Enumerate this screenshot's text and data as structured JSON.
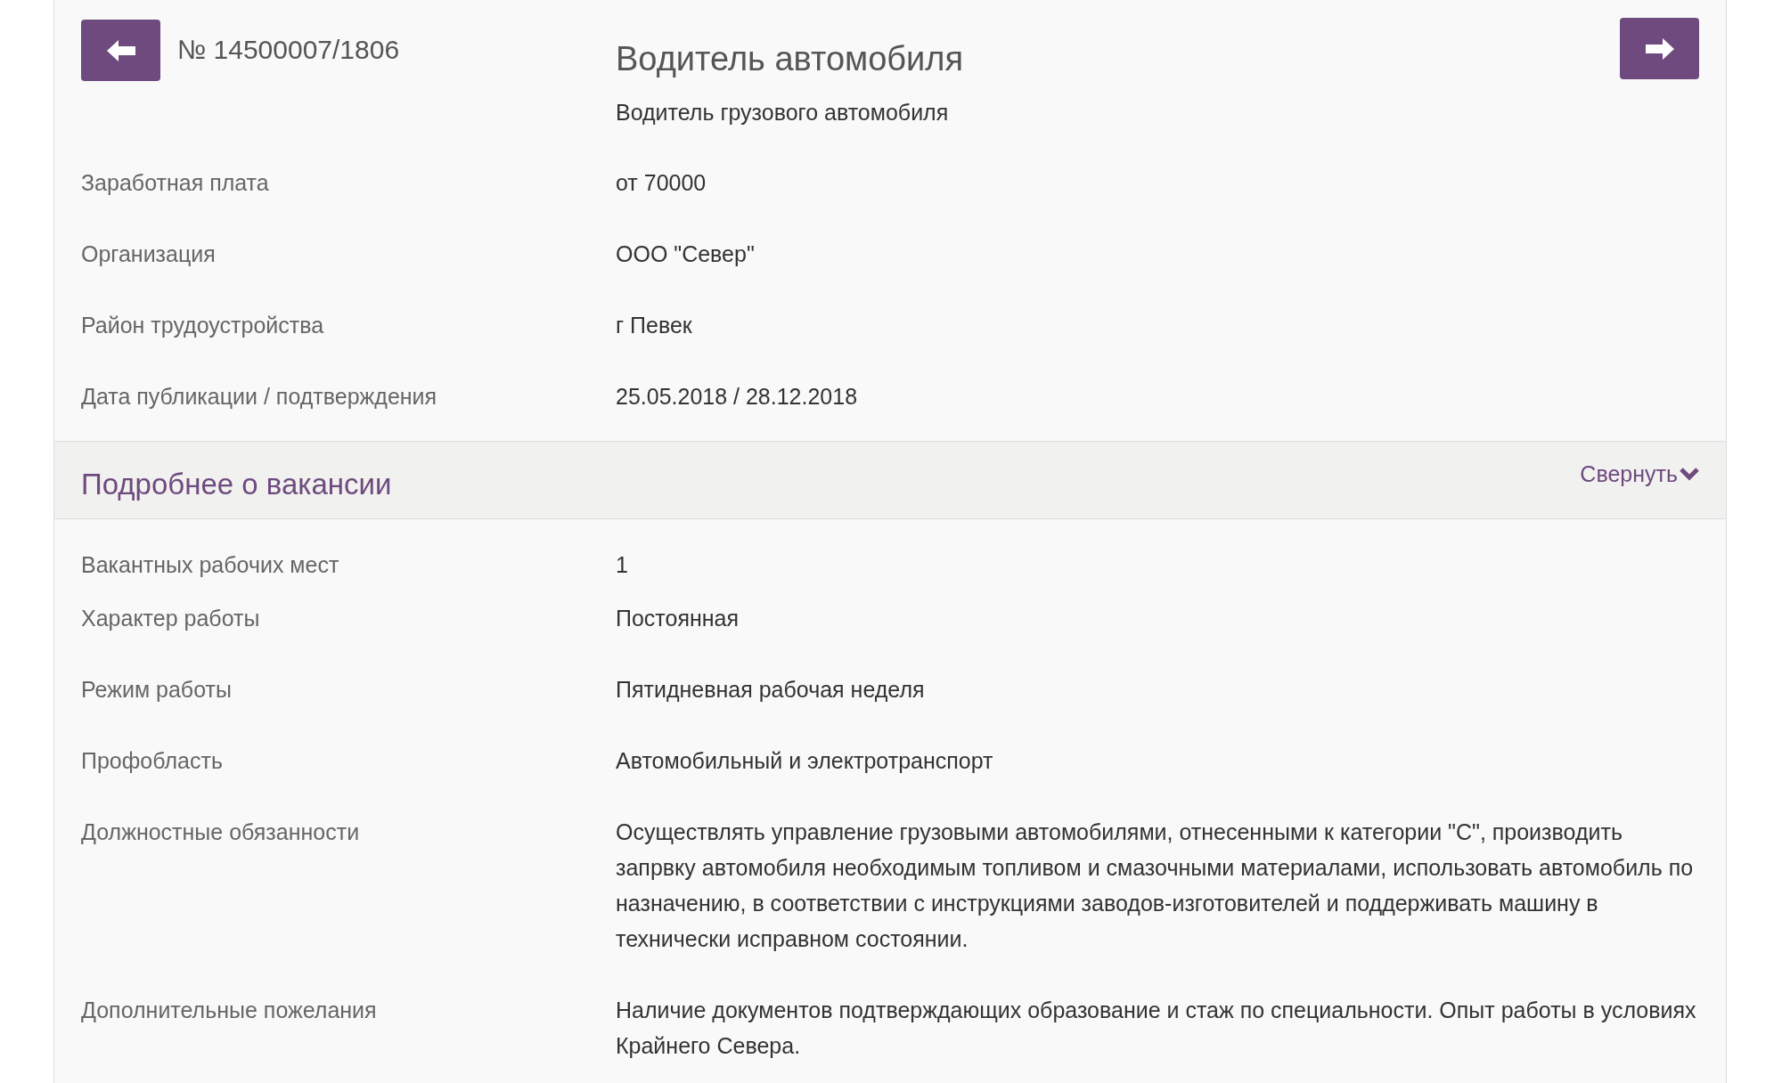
{
  "header": {
    "number": "№ 14500007/1806",
    "title": "Водитель автомобиля",
    "subtitle": "Водитель грузового автомобиля"
  },
  "fields": [
    {
      "label": "Заработная плата",
      "value": "от 70000"
    },
    {
      "label": "Организация",
      "value": "ООО \"Север\""
    },
    {
      "label": "Район трудоустройства",
      "value": "г Певек"
    },
    {
      "label": "Дата публикации / подтверждения",
      "value": "25.05.2018 / 28.12.2018"
    }
  ],
  "details": {
    "title": "Подробнее о вакансии",
    "toggle": "Свернуть",
    "expanded": true,
    "fields": [
      {
        "label": "Вакантных рабочих мест",
        "value": "1"
      },
      {
        "label": "Характер работы",
        "value": "Постоянная"
      },
      {
        "label": "Режим работы",
        "value": "Пятидневная рабочая неделя"
      },
      {
        "label": "Профобласть",
        "value": "Автомобильный и электротранспорт"
      },
      {
        "label": "Должностные обязанности",
        "value": "Осуществлять управление грузовыми автомобилями, отнесенными к категории \"С\", производить запрвку автомобиля необходимым топливом и смазочными материалами, использовать автомобиль по назначению, в соответствии с инструкциями заводов-изготовителей и поддерживать машину в технически исправном состоянии."
      },
      {
        "label": "Дополнительные пожелания",
        "value": "Наличие документов подтверждающих образование и стаж по специальности. Опыт работы в условиях Крайнего Севера."
      }
    ]
  }
}
